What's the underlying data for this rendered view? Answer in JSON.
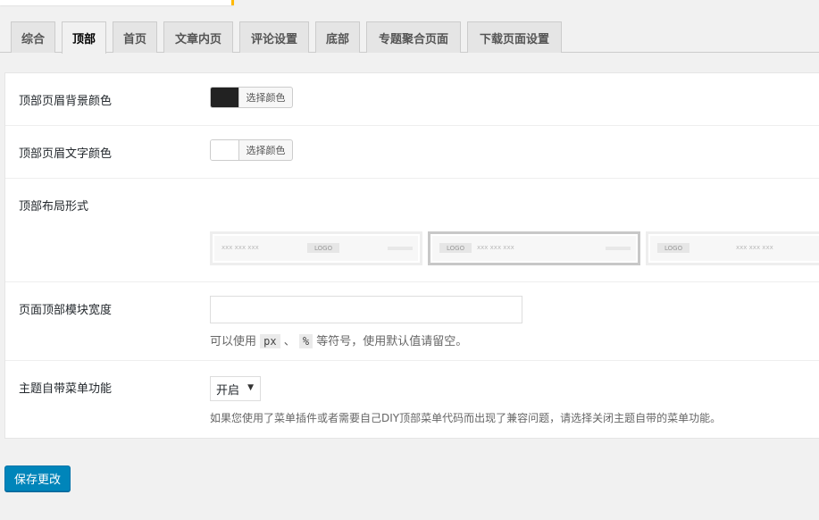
{
  "tabs": [
    {
      "label": "综合"
    },
    {
      "label": "顶部",
      "active": true
    },
    {
      "label": "首页"
    },
    {
      "label": "文章内页"
    },
    {
      "label": "评论设置"
    },
    {
      "label": "底部"
    },
    {
      "label": "专题聚合页面"
    },
    {
      "label": "下载页面设置"
    }
  ],
  "settings": {
    "header_bg_color": {
      "label": "顶部页眉背景颜色",
      "picker_label": "选择颜色",
      "value": "#222222"
    },
    "header_text_color": {
      "label": "顶部页眉文字颜色",
      "picker_label": "选择颜色",
      "value": "#ffffff"
    },
    "layout": {
      "label": "顶部布局形式",
      "selected_index": 1,
      "options": [
        {
          "text": "xxx xxx xxx",
          "logo": "LOGO"
        },
        {
          "logo": "LOGO",
          "text": "xxx xxx xxx"
        },
        {
          "logo": "LOGO",
          "text": "xxx xxx xxx"
        }
      ]
    },
    "width": {
      "label": "页面顶部模块宽度",
      "value": "",
      "help_before": "可以使用",
      "code1": "px",
      "sep": "、",
      "code2": "%",
      "help_after": "等符号，使用默认值请留空。"
    },
    "menu": {
      "label": "主题自带菜单功能",
      "selected": "开启",
      "help": "如果您使用了菜单插件或者需要自己DIY顶部菜单代码而出现了兼容问题，请选择关闭主题自带的菜单功能。"
    }
  },
  "save_button": {
    "label": "保存更改"
  },
  "colors": {
    "accent": "#0085ba",
    "notice": "#ffb900"
  }
}
